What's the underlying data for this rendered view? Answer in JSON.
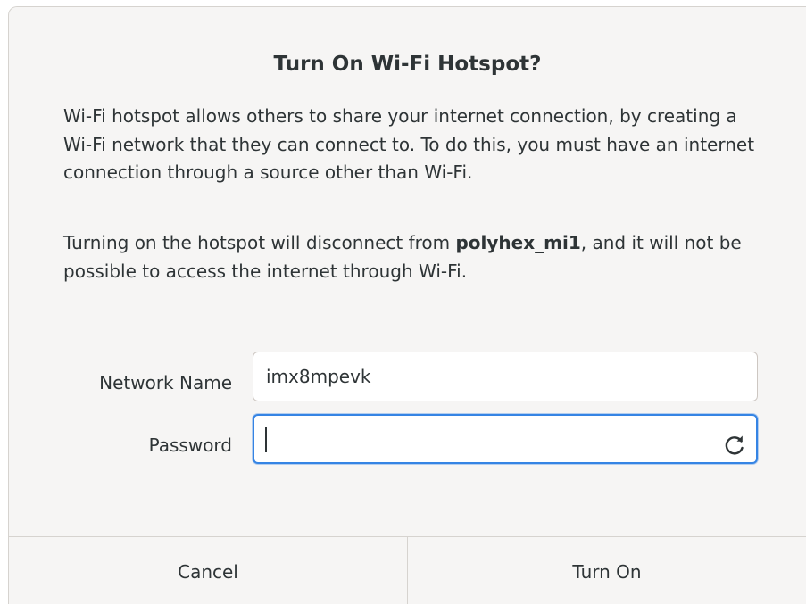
{
  "dialog": {
    "title": "Turn On Wi-Fi Hotspot?",
    "description": "Wi-Fi hotspot allows others to share your internet connection, by creating a Wi-Fi network that they can connect to. To do this, you must have an internet connection through a source other than Wi-Fi.",
    "warning_prefix": "Turning on the hotspot will disconnect from ",
    "warning_network": "polyhex_mi1",
    "warning_suffix": ", and it will not be possible to access the internet through Wi-Fi."
  },
  "form": {
    "network_name_label": "Network Name",
    "network_name_value": "imx8mpevk",
    "password_label": "Password",
    "password_value": "",
    "regenerate_icon": "refresh-icon"
  },
  "buttons": {
    "cancel_label": "Cancel",
    "turn_on_label": "Turn On"
  },
  "colors": {
    "accent": "#3584e4",
    "background": "#f6f5f4",
    "text": "#2e3436"
  }
}
